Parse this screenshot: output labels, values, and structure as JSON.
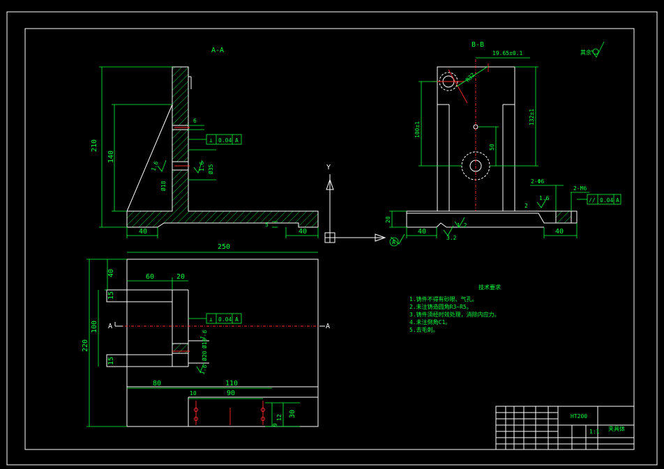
{
  "views": {
    "section_a": "A-A",
    "section_b": "B-B",
    "plan_left_label": "A",
    "plan_right_label": "A"
  },
  "dimensions": {
    "front": {
      "overall_height": "210",
      "rib_height": "140",
      "thickness_6": "6",
      "base_left": "40",
      "base_right": "40",
      "slot_5": "5",
      "hole_dia": "Ø35",
      "hole_dia_small": "Ø18",
      "rough_1": "1.6",
      "rough_2": "1.6"
    },
    "plan": {
      "overall_width": "250",
      "overall_depth": "220",
      "left_60": "60",
      "left_20": "20",
      "top_40": "40",
      "slot_15a": "15",
      "slot_15b": "15",
      "mid_100": "100",
      "bottom_80": "80",
      "bottom_110": "110",
      "hole_10": "10",
      "hole_90": "90",
      "hole_12": "12",
      "hole_9": "9",
      "hole_30": "30",
      "hole_d20": "Ø20",
      "hole_d16": "Ø16",
      "rough": "1.6",
      "rough2": "1.6"
    },
    "side": {
      "offset": "19.65±0.1",
      "radius": "R32",
      "height_left": "100±1",
      "height_right": "132±1",
      "dim_50": "50",
      "base_20": "20",
      "base_40_left": "40",
      "base_40_right": "40",
      "hole_tap": "2-M6",
      "hole_drill": "2-Φ6",
      "rough_16": "1.6",
      "rough_32": "3.2",
      "dim_2": "2",
      "rough_12": "1.2"
    }
  },
  "tolerance_frames": {
    "front_perp": {
      "symbol": "⊥",
      "value": "0.04",
      "datum": "A"
    },
    "plan_perp": {
      "symbol": "⊥",
      "value": "0.04",
      "datum": "A"
    },
    "side_par": {
      "symbol": "//",
      "value": "0.04",
      "datum": "A"
    }
  },
  "axes": {
    "y": "Y"
  },
  "surface_note": "其余",
  "tech_requirements": {
    "title": "技术要求",
    "lines": [
      "1.铸件不得有砂眼、气孔。",
      "2.未注铸造圆角R3~R5。",
      "3.铸件须经时效处理，消除内应力。",
      "4.未注倒角C1。",
      "5.去毛刺。"
    ]
  },
  "title_block": {
    "material": "HT200",
    "scale": "1:1",
    "name": "夹具体"
  },
  "colors": {
    "background": "#000000",
    "outline": "#ffffff",
    "dimension": "#00ff3c",
    "centerline": "#ff2a2a"
  }
}
